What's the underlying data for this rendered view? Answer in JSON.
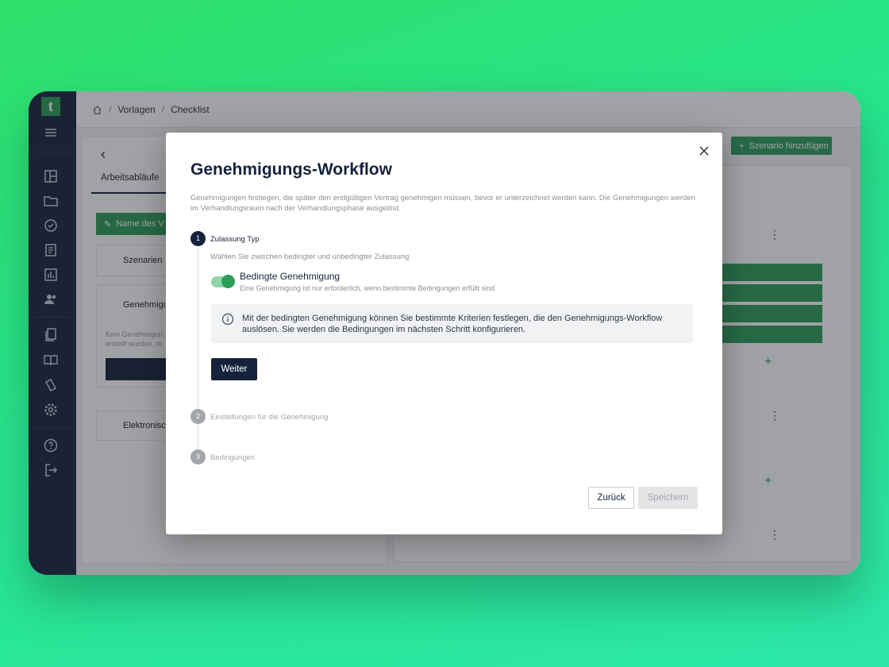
{
  "colors": {
    "sidebar": "#17253f",
    "brand_green": "#2e9e5b",
    "primary_dark": "#16223b",
    "muted_text": "#8a8f98"
  },
  "breadcrumb": {
    "home_icon": "home-icon",
    "items": [
      "Vorlagen",
      "Checklist"
    ]
  },
  "sidebar": {
    "logo": "t",
    "icons": [
      "menu-icon",
      "dashboard-icon",
      "folder-icon",
      "check-circle-icon",
      "document-icon",
      "chart-icon",
      "users-icon",
      "files-icon",
      "book-icon",
      "tags-icon",
      "gear-icon",
      "help-icon",
      "logout-icon"
    ]
  },
  "background": {
    "tab_label": "Arbeitsabläufe",
    "name_button": "Name des V",
    "scenarios_label": "Szenarien",
    "approvals_label": "Genehmigu",
    "approvals_empty_line1": "Kein Genehmigun",
    "approvals_empty_line2": "erstellt wurden, m",
    "electronic_label": "Elektronisc",
    "add_scenario_button": "Szenario hinzufügen"
  },
  "modal": {
    "title": "Genehmigungs-Workflow",
    "description": "Genehmigungen festlegen, die später den endgültigen Vertrag genehmigen müssen, bevor er unterzeichnet werden kann. Die Genehmigungen werden im Verhandlungsraum nach der Verhandlungsphase ausgelöst.",
    "steps": [
      {
        "number": "1",
        "label": "Zulassung Typ",
        "sub": "Wählen Sie zwischen bedingter und unbedingter Zulassung",
        "active": true
      },
      {
        "number": "2",
        "label": "Einstellungen für die Genehmigung",
        "active": false
      },
      {
        "number": "3",
        "label": "Bedingungen",
        "active": false
      }
    ],
    "toggle": {
      "title": "Bedingte Genehmigung",
      "subtitle": "Eine Genehmigung ist nur erforderlich, wenn bestimmte Bedingungen erfüllt sind",
      "checked": true
    },
    "info": "Mit der bedingten Genehmigung können Sie bestimmte Kriterien festlegen, die den Genehmigungs-Workflow auslösen. Sie werden die Bedingungen im nächsten Schritt konfigurieren.",
    "next_button": "Weiter",
    "back_button": "Zurück",
    "save_button": "Speichern"
  }
}
